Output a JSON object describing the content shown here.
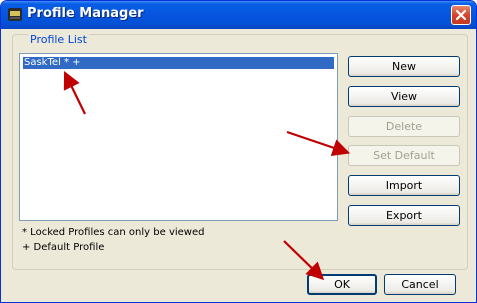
{
  "window": {
    "title": "Profile Manager"
  },
  "profile_list": {
    "group_label": "Profile List",
    "items": [
      "SaskTel * +"
    ],
    "selected_index": 0
  },
  "buttons": {
    "new": "New",
    "view": "View",
    "delete": "Delete",
    "set_default": "Set Default",
    "import": "Import",
    "export": "Export",
    "ok": "OK",
    "cancel": "Cancel"
  },
  "legend": {
    "locked": "* Locked Profiles can only be viewed",
    "default": "+ Default Profile"
  },
  "colors": {
    "titlebar": "#0655df",
    "selection": "#316ac5",
    "annotation_arrow": "#c00000",
    "dialog_bg": "#ece9d8"
  },
  "icons": [
    "app-icon",
    "close-icon"
  ]
}
